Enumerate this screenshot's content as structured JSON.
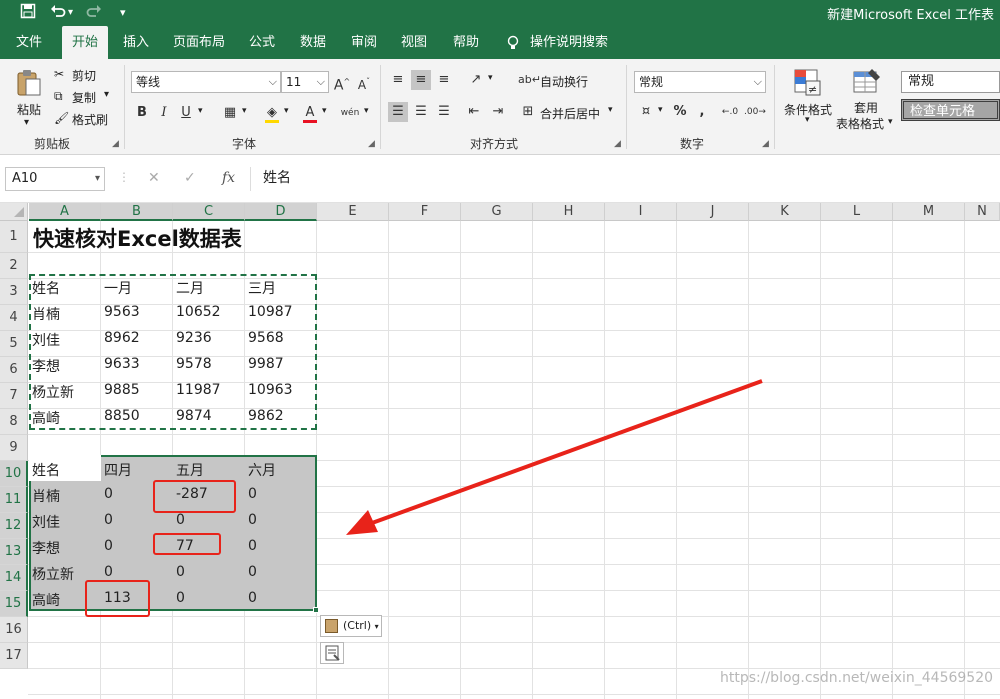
{
  "window": {
    "title": "新建Microsoft Excel 工作表"
  },
  "quick_access": {
    "save_icon": "save-icon",
    "undo_icon": "undo-icon",
    "redo_icon": "redo-icon",
    "customize_icon": "customize-icon"
  },
  "tabs": [
    "文件",
    "开始",
    "插入",
    "页面布局",
    "公式",
    "数据",
    "审阅",
    "视图",
    "帮助",
    "操作说明搜索"
  ],
  "ribbon": {
    "clipboard": {
      "paste": "粘贴",
      "cut": "剪切",
      "copy": "复制",
      "format_painter": "格式刷",
      "label": "剪贴板"
    },
    "font": {
      "font_name": "等线",
      "font_size": "11",
      "grow": "A",
      "shrink": "A",
      "bold": "B",
      "italic": "I",
      "underline": "U",
      "font_color": "A",
      "phonetic": "wén",
      "label": "字体"
    },
    "alignment": {
      "wrap": "自动换行",
      "merge": "合并后居中",
      "label": "对齐方式"
    },
    "number": {
      "format": "常规",
      "percent": "%",
      "comma": ",",
      "label": "数字"
    },
    "styles": {
      "conditional": "条件格式",
      "table_line1": "套用",
      "table_line2": "表格格式",
      "style_normal": "常规",
      "style_check": "检查单元格"
    }
  },
  "formula_bar": {
    "name_box": "A10",
    "fx": "fx",
    "content": "姓名"
  },
  "grid": {
    "columns": [
      "A",
      "B",
      "C",
      "D",
      "E",
      "F",
      "G",
      "H",
      "I",
      "J",
      "K",
      "L",
      "M",
      "N"
    ],
    "rows": [
      "1",
      "2",
      "3",
      "4",
      "5",
      "6",
      "7",
      "8",
      "9",
      "10",
      "11",
      "12",
      "13",
      "14",
      "15",
      "16",
      "17"
    ],
    "title": "快速核对Excel数据表",
    "table1": {
      "header": [
        "姓名",
        "一月",
        "二月",
        "三月"
      ],
      "rows": [
        [
          "肖楠",
          "9563",
          "10652",
          "10987"
        ],
        [
          "刘佳",
          "8962",
          "9236",
          "9568"
        ],
        [
          "李想",
          "9633",
          "9578",
          "9987"
        ],
        [
          "杨立新",
          "9885",
          "11987",
          "10963"
        ],
        [
          "高崎",
          "8850",
          "9874",
          "9862"
        ]
      ]
    },
    "table2": {
      "header": [
        "姓名",
        "四月",
        "五月",
        "六月"
      ],
      "rows": [
        [
          "肖楠",
          "0",
          "-287",
          "0"
        ],
        [
          "刘佳",
          "0",
          "0",
          "0"
        ],
        [
          "李想",
          "0",
          "77",
          "0"
        ],
        [
          "杨立新",
          "0",
          "0",
          "0"
        ],
        [
          "高崎",
          "113",
          "0",
          "0"
        ]
      ]
    }
  },
  "paste_options": {
    "label": "(Ctrl)"
  },
  "watermark": "https://blog.csdn.net/weixin_44569520",
  "colors": {
    "accent": "#217346",
    "highlight_red": "#e8231a",
    "selection_gray": "#c6c6c6"
  }
}
